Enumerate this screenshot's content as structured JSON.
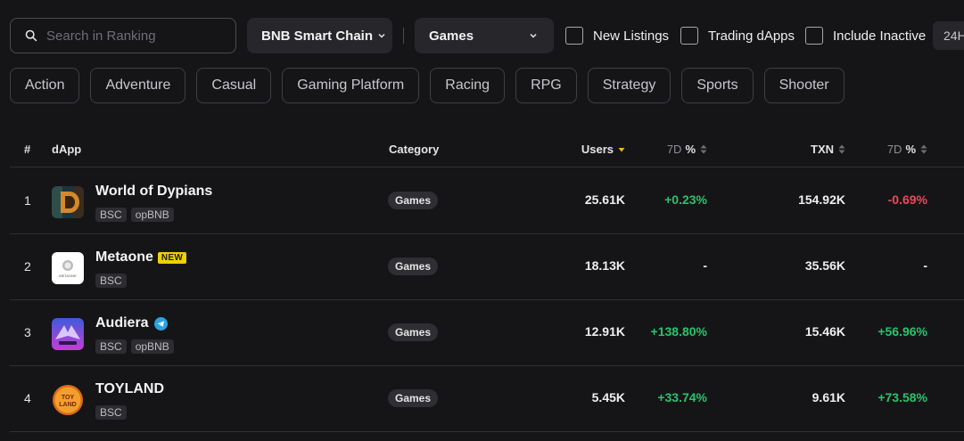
{
  "search": {
    "placeholder": "Search in Ranking"
  },
  "filters": {
    "chain": "BNB Smart Chain",
    "category": "Games",
    "new_listings": "New Listings",
    "trading_dapps": "Trading dApps",
    "include_inactive": "Include Inactive",
    "period": "24H"
  },
  "chips": [
    "Action",
    "Adventure",
    "Casual",
    "Gaming Platform",
    "Racing",
    "RPG",
    "Strategy",
    "Sports",
    "Shooter"
  ],
  "table": {
    "headers": {
      "rank": "#",
      "dapp": "dApp",
      "category": "Category",
      "users": "Users",
      "users_7d_prefix": "7D",
      "users_7d_pct": "%",
      "txn": "TXN",
      "txn_7d_prefix": "7D",
      "txn_7d_pct": "%"
    },
    "rows": [
      {
        "rank": "1",
        "name": "World of Dypians",
        "new_badge": "",
        "tags": [
          "BSC",
          "opBNB"
        ],
        "category": "Games",
        "users": "25.61K",
        "users_7d": "+0.23%",
        "txn": "154.92K",
        "txn_7d": "-0.69%"
      },
      {
        "rank": "2",
        "name": "Metaone",
        "new_badge": "NEW",
        "tags": [
          "BSC"
        ],
        "category": "Games",
        "users": "18.13K",
        "users_7d": "-",
        "txn": "35.56K",
        "txn_7d": "-"
      },
      {
        "rank": "3",
        "name": "Audiera",
        "new_badge": "",
        "tags": [
          "BSC",
          "opBNB"
        ],
        "category": "Games",
        "users": "12.91K",
        "users_7d": "+138.80%",
        "txn": "15.46K",
        "txn_7d": "+56.96%"
      },
      {
        "rank": "4",
        "name": "TOYLAND",
        "new_badge": "",
        "tags": [
          "BSC"
        ],
        "category": "Games",
        "users": "5.45K",
        "users_7d": "+33.74%",
        "txn": "9.61K",
        "txn_7d": "+73.58%"
      }
    ]
  },
  "logos": {
    "metaone_text": "METAONE",
    "toyland_line1": "TOY",
    "toyland_line2": "LAND"
  },
  "icons": {
    "search": "search-icon",
    "dropdown": "chevron-down-icon",
    "verified": "telegram-icon",
    "sort": "sort-icon"
  },
  "colors": {
    "positive": "#27c46b",
    "negative": "#f0475a",
    "sort_active": "#f0b90b",
    "new_badge": "#f0d000"
  }
}
